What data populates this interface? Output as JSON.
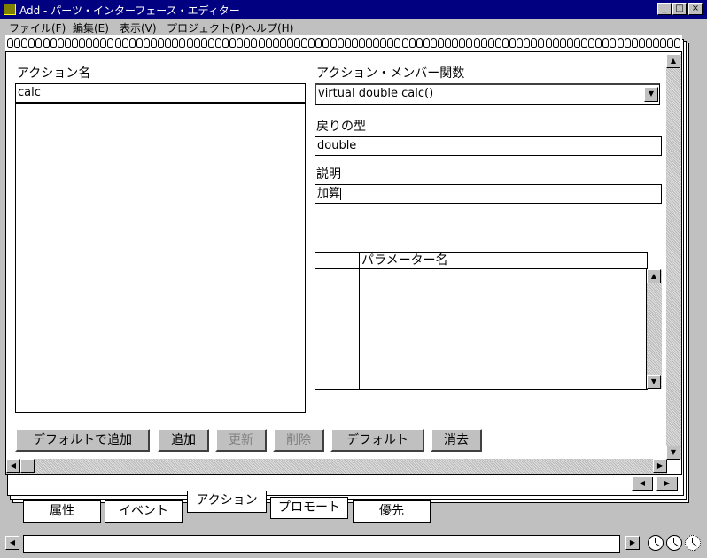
{
  "window": {
    "title": "Add - パーツ・インターフェース・エディター",
    "minimize": "_",
    "maximize": "□",
    "close": "×"
  },
  "menu": [
    "ファイル(F)",
    "編集(E)",
    "表示(V)",
    "プロジェクト(P)",
    "ヘルプ(H)"
  ],
  "left": {
    "action_name_label": "アクション名",
    "action_name_value": "calc"
  },
  "right": {
    "member_func_label": "アクション・メンバー関数",
    "member_func_value": "virtual double calc()",
    "return_type_label": "戻りの型",
    "return_type_value": "double",
    "description_label": "説明",
    "description_value": "加算",
    "param_header": "パラメーター名"
  },
  "buttons": {
    "add_default": "デフォルトで追加",
    "add": "追加",
    "update": "更新",
    "delete": "削除",
    "default": "デフォルト",
    "clear": "消去"
  },
  "tabs": [
    "属性",
    "イベント",
    "アクション",
    "プロモート",
    "優先"
  ],
  "icons": {
    "scroll_up": "▲",
    "scroll_down": "▼",
    "scroll_left": "◀",
    "scroll_right": "▶",
    "dropdown": "▼"
  }
}
